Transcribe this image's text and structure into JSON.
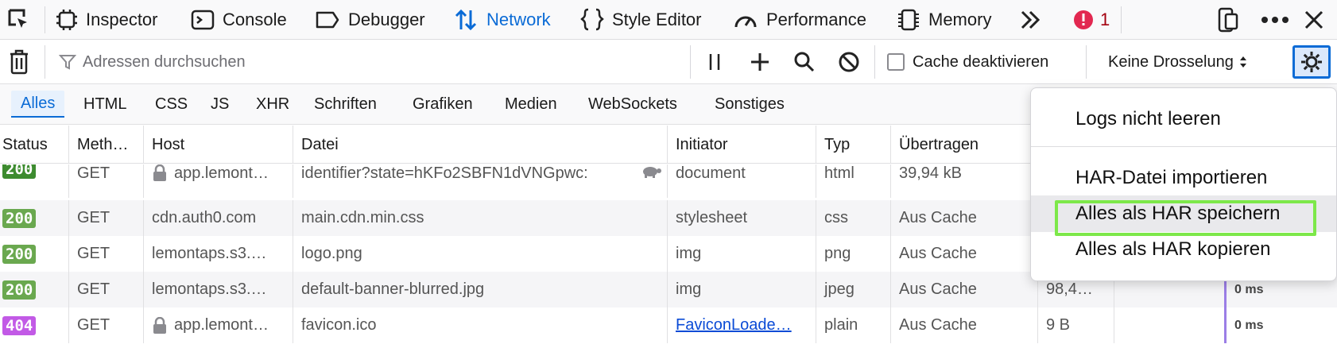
{
  "toolbar": {
    "tabs": [
      {
        "label": "Inspector",
        "icon": "inspector-icon"
      },
      {
        "label": "Console",
        "icon": "console-icon"
      },
      {
        "label": "Debugger",
        "icon": "debugger-icon"
      },
      {
        "label": "Network",
        "icon": "network-icon",
        "active": true
      },
      {
        "label": "Style Editor",
        "icon": "style-editor-icon"
      },
      {
        "label": "Performance",
        "icon": "performance-icon"
      },
      {
        "label": "Memory",
        "icon": "memory-icon"
      }
    ],
    "error_count": "1"
  },
  "filterbar": {
    "search_placeholder": "Adressen durchsuchen",
    "cache_label": "Cache deaktivieren",
    "cache_checked": false,
    "throttle_label": "Keine Drosselung"
  },
  "type_filters": [
    "Alles",
    "HTML",
    "CSS",
    "JS",
    "XHR",
    "Schriften",
    "Grafiken",
    "Medien",
    "WebSockets",
    "Sonstiges"
  ],
  "table": {
    "headers": [
      "Status",
      "Meth…",
      "Host",
      "Datei",
      "Initiator",
      "Typ",
      "Übertragen"
    ],
    "rows": [
      {
        "status": "200",
        "method": "GET",
        "host": "app.lemont…",
        "secure": true,
        "file": "identifier?state=hKFo2SBFN1dVNGpwc:",
        "initiator": "document",
        "type": "html",
        "transferred": "39,94 kB",
        "size": "",
        "time": ""
      },
      {
        "status": "200",
        "method": "GET",
        "host": "cdn.auth0.com",
        "secure": false,
        "file": "main.cdn.min.css",
        "initiator": "stylesheet",
        "type": "css",
        "transferred": "Aus Cache",
        "size": "",
        "time": ""
      },
      {
        "status": "200",
        "method": "GET",
        "host": "lemontaps.s3.…",
        "secure": false,
        "file": "logo.png",
        "initiator": "img",
        "type": "png",
        "transferred": "Aus Cache",
        "size": "",
        "time": ""
      },
      {
        "status": "200",
        "method": "GET",
        "host": "lemontaps.s3.…",
        "secure": false,
        "file": "default-banner-blurred.jpg",
        "initiator": "img",
        "type": "jpeg",
        "transferred": "Aus Cache",
        "size": "98,4…",
        "time": "0 ms"
      },
      {
        "status": "404",
        "method": "GET",
        "host": "app.lemont…",
        "secure": true,
        "file": "favicon.ico",
        "initiator": "FaviconLoade…",
        "type": "plain",
        "transferred": "Aus Cache",
        "size": "9 B",
        "time": "0 ms"
      }
    ]
  },
  "settings_menu": {
    "items": [
      "Logs nicht leeren",
      "HAR-Datei importieren",
      "Alles als HAR speichern",
      "Alles als HAR kopieren"
    ],
    "highlighted_item": "Alles als HAR speichern"
  },
  "colors": {
    "accent": "#0a6bd6",
    "status_200": "#6aa84f",
    "status_200_first": "#3d8b2f",
    "status_404": "#c25ae6",
    "highlight_border": "#7de84a"
  }
}
